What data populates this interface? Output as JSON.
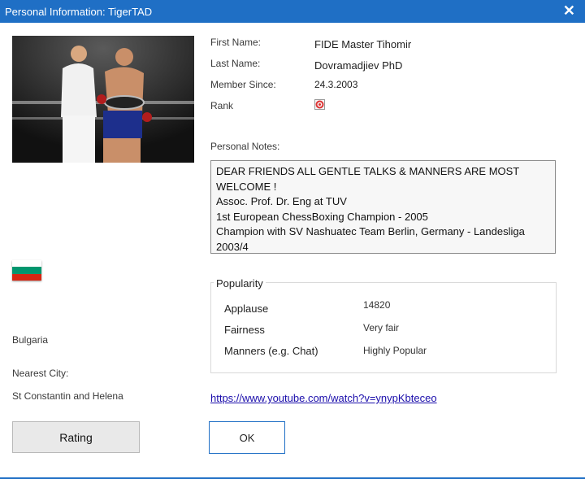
{
  "window": {
    "title": "Personal Information: TigerTAD",
    "close_glyph": "✕"
  },
  "photo": {
    "description_icon": "profile-photo"
  },
  "fields": {
    "first_name_label": "First Name:",
    "first_name_value": "FIDE Master Tihomir",
    "last_name_label": "Last Name:",
    "last_name_value": "Dovramadjiev PhD",
    "member_since_label": "Member Since:",
    "member_since_value": "24.3.2003",
    "rank_label": "Rank",
    "rank_icon": "rank-badge-icon"
  },
  "notes": {
    "label": "Personal Notes:",
    "text": "DEAR FRIENDS ALL GENTLE TALKS & MANNERS ARE MOST WELCOME !\nAssoc. Prof. Dr. Eng at TUV\n1st European ChessBoxing Champion - 2005\nChampion with SV Nashuatec Team Berlin, Germany - Landesliga 2003/4"
  },
  "popularity": {
    "title": "Popularity",
    "rows": [
      {
        "label": "Applause",
        "value": "14820"
      },
      {
        "label": "Fairness",
        "value": "Very fair"
      },
      {
        "label": "Manners (e.g. Chat)",
        "value": "Highly Popular"
      }
    ]
  },
  "location": {
    "flag_colors": [
      "#ffffff",
      "#00966e",
      "#d62612"
    ],
    "country": "Bulgaria",
    "nearest_city_label": "Nearest City:",
    "nearest_city_value": "St Constantin and Helena"
  },
  "link": {
    "url_text": "https://www.youtube.com/watch?v=ynypKbteceo"
  },
  "buttons": {
    "rating": "Rating",
    "ok": "OK"
  },
  "colors": {
    "accent": "#1f6fc5",
    "link": "#1a0dab"
  }
}
